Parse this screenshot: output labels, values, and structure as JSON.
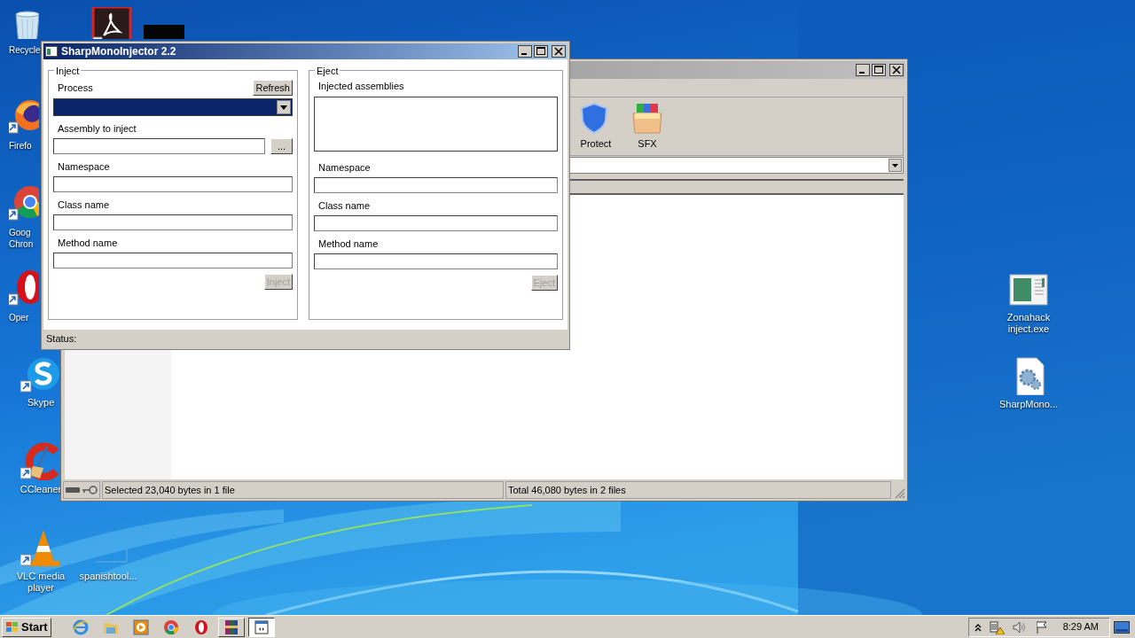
{
  "desktop_icons": [
    {
      "kind": "recycle",
      "label": "Recycle"
    },
    {
      "kind": "pdf"
    },
    {
      "kind": "dark"
    },
    {
      "kind": "firefox",
      "label": "Firefo"
    },
    {
      "kind": "chrome",
      "label": "Goog Chron"
    },
    {
      "kind": "opera",
      "label": "Oper"
    },
    {
      "kind": "skype",
      "label": "Skype"
    },
    {
      "kind": "ccleaner",
      "label": "CCleaner"
    },
    {
      "kind": "vlc",
      "label": "VLC media player"
    },
    {
      "kind": "blank",
      "label": "spanishtool..."
    },
    {
      "kind": "app",
      "label": "Zonahack inject.exe"
    },
    {
      "kind": "config",
      "label": "SharpMono..."
    }
  ],
  "background_window": {
    "toolbar": [
      {
        "kind": "shield",
        "label": "Protect"
      },
      {
        "kind": "box",
        "label": "SFX"
      }
    ],
    "status": [
      "Selected 23,040 bytes in 1 file",
      "Total 46,080 bytes in 2 files"
    ]
  },
  "injector": {
    "title": "SharpMonoInjector 2.2",
    "inject": {
      "title": "Inject",
      "process_label": "Process",
      "refresh": "Refresh",
      "process_focused": true,
      "fields": [
        {
          "label": "Assembly to inject",
          "browse": "..."
        },
        {
          "label": "Namespace"
        },
        {
          "label": "Class name"
        },
        {
          "label": "Method name"
        }
      ],
      "button": {
        "label": "Inject",
        "disabled": true
      }
    },
    "eject": {
      "title": "Eject",
      "list_label": "Injected assemblies",
      "fields": [
        {
          "label": "Namespace"
        },
        {
          "label": "Class name"
        },
        {
          "label": "Method name"
        }
      ],
      "button": {
        "label": "Eject",
        "disabled": true
      }
    },
    "status": "Status:"
  },
  "taskbar": {
    "start": "Start",
    "apps": [
      {
        "kind": "ie",
        "selected": false
      },
      {
        "kind": "folder",
        "selected": false
      },
      {
        "kind": "media",
        "selected": false
      },
      {
        "kind": "chrome",
        "selected": false
      },
      {
        "kind": "opera",
        "selected": false
      },
      {
        "kind": "winrar",
        "selected": false
      },
      {
        "kind": "window",
        "selected": true
      }
    ],
    "clock": "8:29 AM"
  }
}
